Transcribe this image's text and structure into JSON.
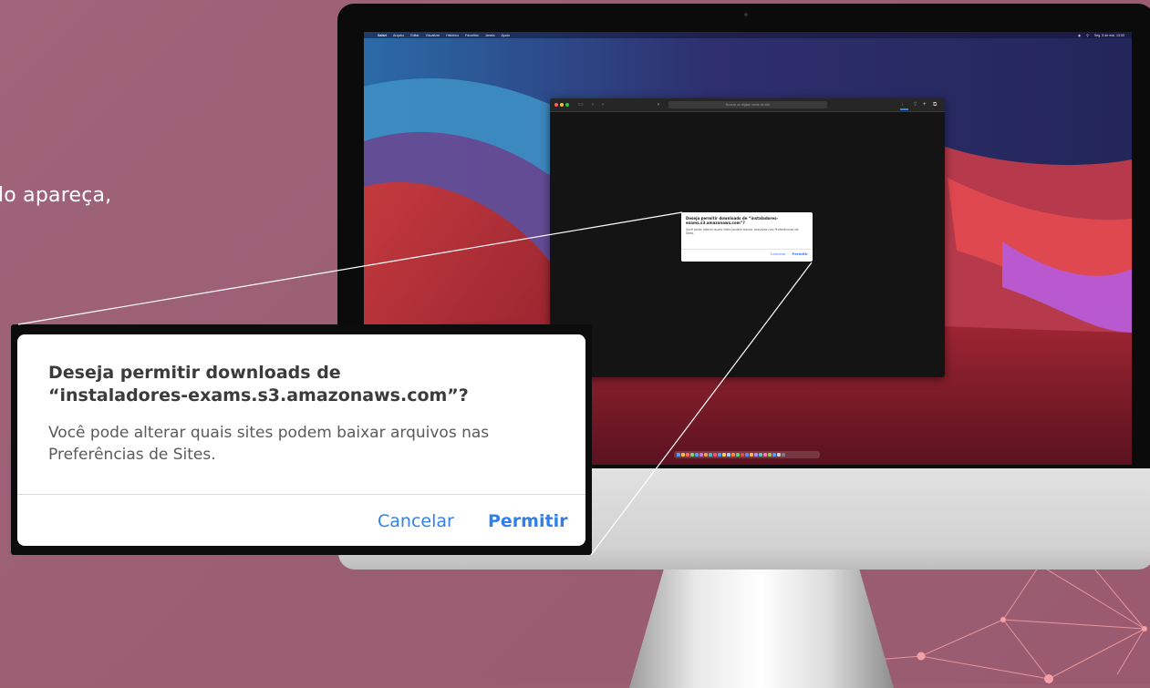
{
  "intro_text": "lo apareça,",
  "colors": {
    "slide_background": "#9c5f72",
    "link_blue": "#2f80ea",
    "accent_line": "#f4a0a6"
  },
  "menubar": {
    "items": [
      "Safari",
      "Arquivo",
      "Editar",
      "Visualizar",
      "Histórico",
      "Favoritos",
      "Janela",
      "Ajuda"
    ],
    "clock": "Seg. 5 de mai. 13:53"
  },
  "browser": {
    "address_placeholder": "Buscar ou digitar nome do site"
  },
  "dialog": {
    "title": "Deseja permitir downloads de “instaladores-exams.s3.amazonaws.com”?",
    "body": "Você pode alterar quais sites podem baixar arquivos nas Preferências de Sites.",
    "cancel_label": "Cancelar",
    "allow_label": "Permitir"
  },
  "mini_dialog": {
    "title": "Deseja permitir downloads de “instaladores-exams.s3.amazonaws.com”?",
    "body": "Você pode alterar quais sites podem baixar arquivos nas Preferências de Sites.",
    "cancel_label": "Cancelar",
    "allow_label": "Permitir"
  },
  "icons": {
    "apple_logo": "apple-logo",
    "sidebar": "sidebar-icon",
    "back": "back-arrow-icon",
    "forward": "forward-arrow-icon",
    "shield": "privacy-shield-icon",
    "download": "download-icon",
    "share": "share-icon",
    "new_tab": "new-tab-icon",
    "tabs": "tab-overview-icon"
  }
}
